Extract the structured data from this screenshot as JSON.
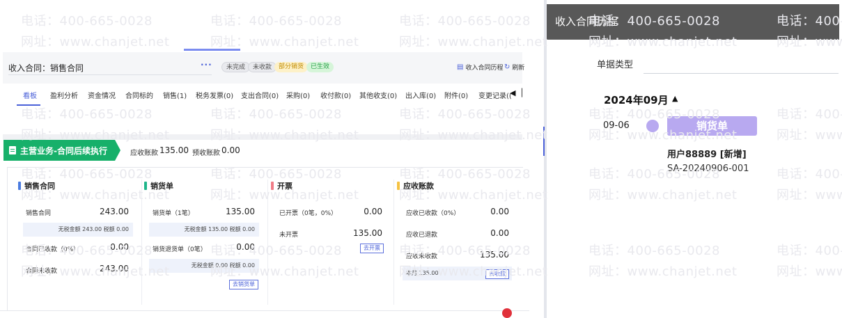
{
  "watermark": {
    "phone": "电话：400-665-0028",
    "site": "网址：www.chanjet.net"
  },
  "header": {
    "title": "收入合同：销售合同",
    "more_label": "···",
    "tags": [
      "未完成",
      "未收款",
      "部分销货",
      "已生效"
    ],
    "history_label": "收入合同历程",
    "refresh_label": "刷新"
  },
  "tabs": [
    {
      "label": "看板"
    },
    {
      "label": "盈利分析"
    },
    {
      "label": "资金情况"
    },
    {
      "label": "合同标的"
    },
    {
      "label": "销售(1)"
    },
    {
      "label": "税务发票(0)"
    },
    {
      "label": "支出合同(0)"
    },
    {
      "label": "采购(0)"
    },
    {
      "label": "收付款(0)"
    },
    {
      "label": "其他收支(0)"
    },
    {
      "label": "出入库(0)"
    },
    {
      "label": "附件(0)"
    },
    {
      "label": "变更记录(("
    }
  ],
  "summary": {
    "section_label": "主营业务-合同后续执行",
    "receivable_label": "应收账款",
    "receivable_value": "135.00",
    "prepaid_label": "预收账款",
    "prepaid_value": "0.00"
  },
  "cards": {
    "contract": {
      "title": "销售合同",
      "color": "#4a7be0",
      "row1_label": "销售合同",
      "row1_value": "243.00",
      "note": "无税金额 243.00 税额 0.00",
      "row2_label": "合同已收款（0%）",
      "row2_value": "0.00",
      "row3_label": "合同未收款",
      "row3_value": "243.00"
    },
    "delivery": {
      "title": "销货单",
      "color": "#1fb58a",
      "row1_label": "销货单（1笔）",
      "row1_value": "135.00",
      "note1": "无税金额 135.00 税额 0.00",
      "row2_label": "销货退货单（0笔）",
      "row2_value": "0.00",
      "note2": "无税金额 0.00 税额 0.00",
      "button": "去销货单"
    },
    "invoice": {
      "title": "开票",
      "color": "#f07c87",
      "row1_label": "已开票（0笔，0%）",
      "row1_value": "0.00",
      "row2_label": "未开票",
      "row2_value": "135.00",
      "button": "去开票"
    },
    "receivable": {
      "title": "应收账款",
      "color": "#f5c242",
      "row1_label": "应收已收款（0%）",
      "row1_value": "0.00",
      "row2_label": "应收已退款",
      "row2_value": "0.00",
      "row3_label": "应收未收款",
      "row3_value": "135.00",
      "month_label": "本月 135.00",
      "button": "去收款"
    }
  },
  "history_panel": {
    "title": "收入合同历程",
    "filter_label": "单据类型",
    "month": "2024年09月",
    "entry": {
      "date": "09-06",
      "type": "销货单",
      "user": "用户88889 [新增]",
      "code": "SA-20240906-001"
    }
  }
}
